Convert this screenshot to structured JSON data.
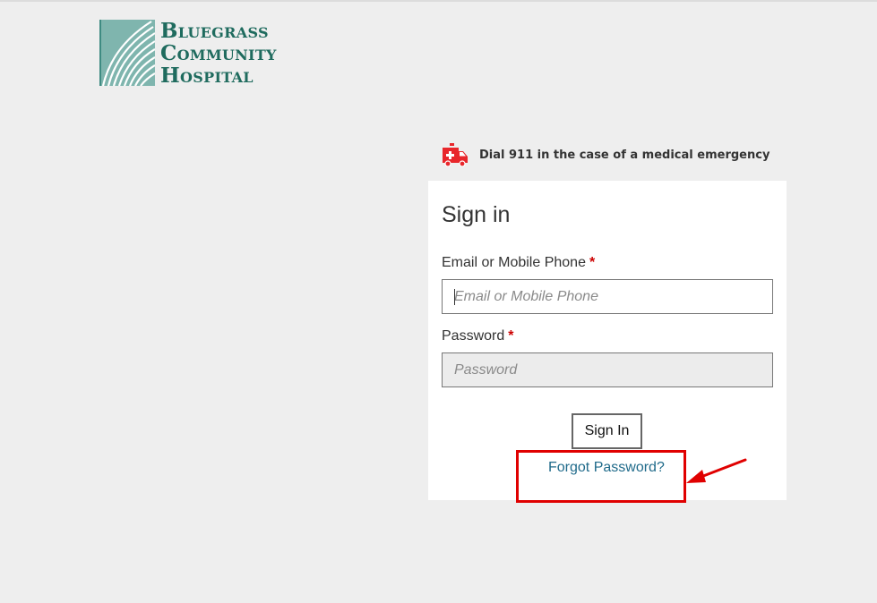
{
  "brand": {
    "line1": {
      "cap": "B",
      "rest": "LUEGRASS"
    },
    "line2": {
      "cap": "C",
      "rest": "OMMUNITY"
    },
    "line3": {
      "cap": "H",
      "rest": "OSPITAL"
    },
    "color": "#1f6b5e"
  },
  "emergency": {
    "icon": "ambulance-icon",
    "text": "Dial 911 in the case of a medical emergency",
    "icon_color": "#e8262b"
  },
  "signin": {
    "title": "Sign in",
    "email": {
      "label": "Email or Mobile Phone",
      "required_mark": "*",
      "placeholder": "Email or Mobile Phone",
      "value": ""
    },
    "password": {
      "label": "Password",
      "required_mark": "*",
      "placeholder": "Password",
      "value": ""
    },
    "submit_label": "Sign In",
    "forgot_label": "Forgot Password?",
    "link_color": "#1f6a8a",
    "required_color": "#cc0000"
  },
  "annotation": {
    "color": "#e00000"
  }
}
